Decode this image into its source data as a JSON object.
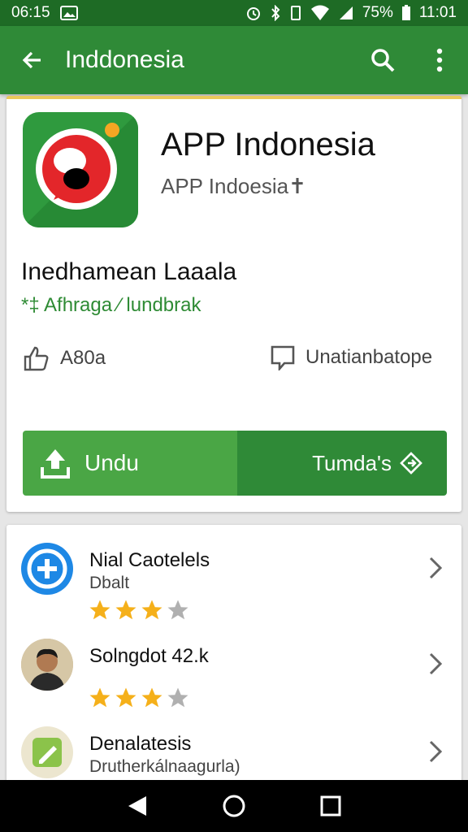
{
  "status_bar": {
    "left_text": "06:15",
    "battery": "75%",
    "time": "11:01",
    "icons": [
      "image-icon",
      "alarm-icon",
      "bluetooth-icon",
      "vibrate-icon",
      "wifi-icon",
      "signal-icon",
      "battery-icon"
    ]
  },
  "app_bar": {
    "title": "Inddonesia",
    "back_icon": "arrow-back-icon",
    "search_icon": "search-icon",
    "menu_icon": "more-vert-icon"
  },
  "app": {
    "name": "APP Indonesia",
    "developer": "APP Indoesia",
    "developer_badge": "✝",
    "headline": "Inedhamean Laaala",
    "subline": "*‡ Afhraga ⁄ lundbrak",
    "stat_left": "A80a",
    "stat_right": "Unatianbatope",
    "accent": "#2f8a37",
    "accent_light": "#4aa645"
  },
  "buttons": {
    "install_label": "Undu",
    "second_label": "Tumda's"
  },
  "list": [
    {
      "title": "Nial Caotelels",
      "subtitle": "Dbalt",
      "rating": 3,
      "max": 4,
      "avatar": "plus-icon"
    },
    {
      "title": "Solngdot 42.k",
      "subtitle": "",
      "rating": 3,
      "max": 4,
      "avatar": "person-photo"
    },
    {
      "title": "Denalatesis",
      "subtitle": "Drutherkálnaagurla)",
      "rating": 0,
      "max": 0,
      "avatar": "edit-icon"
    }
  ]
}
